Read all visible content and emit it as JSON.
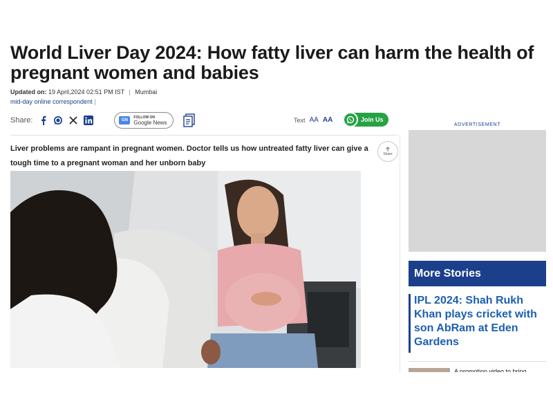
{
  "article": {
    "headline": "World Liver Day 2024: How fatty liver can harm the health of pregnant women and babies",
    "updated_label": "Updated on:",
    "updated_value": "19 April,2024 02:51 PM IST",
    "separator": "|",
    "location": "Mumbai",
    "author": "mid-day online correspondent",
    "author_pipe": "|",
    "standfirst": "Liver problems are rampant in pregnant women. Doctor tells us how untreated fatty liver can give a tough time to a pregnant woman and her unborn baby"
  },
  "share_bar": {
    "label": "Share:",
    "icons": [
      "facebook-icon",
      "whatsapp-icon",
      "x-icon",
      "linkedin-icon"
    ],
    "google_news_top": "FOLLOW ON",
    "google_news_bottom": "Google News",
    "google_news_badge": "GN",
    "text_label": "Text",
    "text_small": "AA",
    "text_large": "AA",
    "join_label": "Join Us",
    "share_circle_label": "Share"
  },
  "sidebar": {
    "ad_label": "ADVERTISEMENT",
    "more_stories_title": "More Stories",
    "story_1_title": "IPL 2024: Shah Rukh Khan plays cricket with son AbRam at Eden Gardens",
    "story_2_title": "A promotion video to bring"
  },
  "colors": {
    "brand_blue": "#1c3f8c",
    "link_blue": "#1c5fb0",
    "whatsapp_green": "#25a244"
  }
}
